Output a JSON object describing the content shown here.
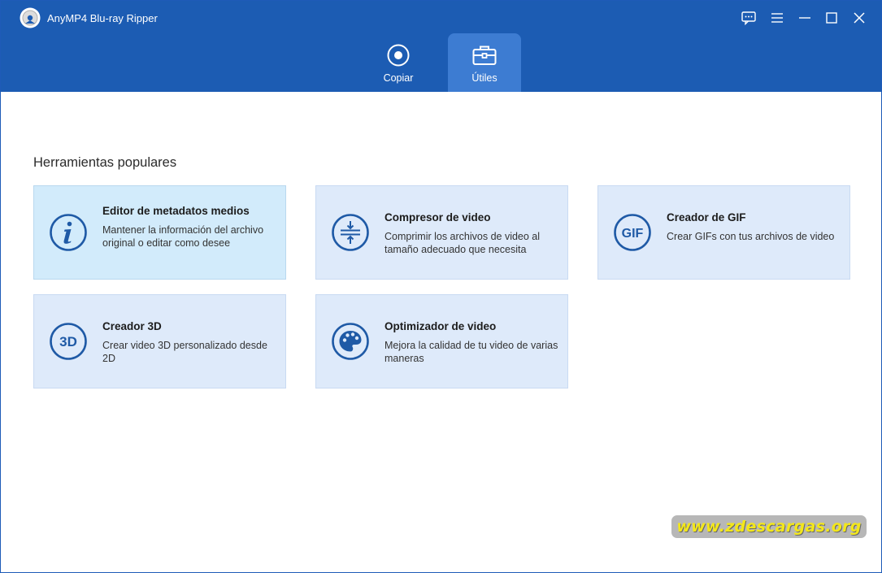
{
  "window": {
    "title": "AnyMP4 Blu-ray Ripper"
  },
  "window_controls": [
    {
      "name": "feedback-icon"
    },
    {
      "name": "menu-icon"
    },
    {
      "name": "minimize-icon"
    },
    {
      "name": "maximize-icon"
    },
    {
      "name": "close-icon"
    }
  ],
  "tabs": [
    {
      "label": "Copiar",
      "icon": "disc-icon",
      "active": false
    },
    {
      "label": "Útiles",
      "icon": "toolbox-icon",
      "active": true
    }
  ],
  "section": {
    "title": "Herramientas populares"
  },
  "tools": [
    {
      "title": "Editor de metadatos medios",
      "description": "Mantener la información del archivo original o editar como desee",
      "icon": "info-icon"
    },
    {
      "title": "Compresor de video",
      "description": "Comprimir los archivos de video al tamaño adecuado que necesita",
      "icon": "compress-icon"
    },
    {
      "title": "Creador de GIF",
      "description": "Crear GIFs con tus archivos de video",
      "icon": "gif-icon",
      "icon_text": "GIF"
    },
    {
      "title": "Creador 3D",
      "description": "Crear video 3D personalizado desde 2D",
      "icon": "3d-icon",
      "icon_text": "3D"
    },
    {
      "title": "Optimizador de video",
      "description": "Mejora la calidad de tu video de varias maneras",
      "icon": "palette-icon"
    }
  ],
  "watermark": {
    "text": "www.zdescargas.org"
  },
  "colors": {
    "titlebar": "#1c5cb3",
    "active_tab": "#3d7cd2",
    "card_bg": "#deeafa",
    "icon": "#1f5aa6"
  }
}
